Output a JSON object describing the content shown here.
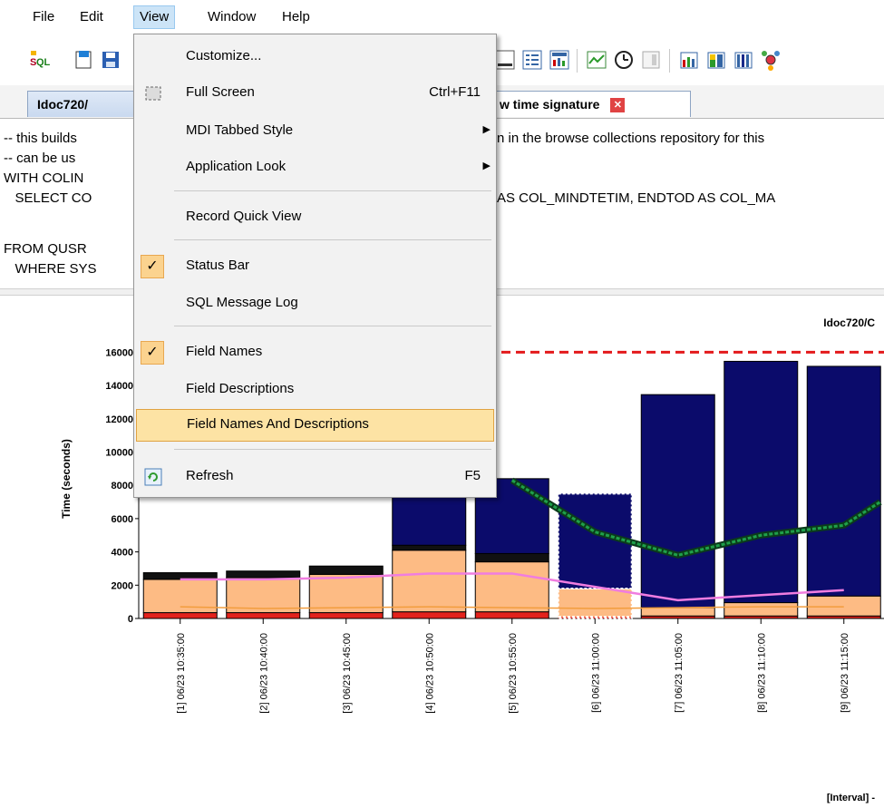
{
  "menubar": {
    "items": [
      "File",
      "Edit",
      "View",
      "Window",
      "Help"
    ]
  },
  "tabs": [
    {
      "label": "Idoc720/"
    },
    {
      "label": "w time signature"
    }
  ],
  "editor": {
    "lines": [
      "-- this builds",
      "-- can be us",
      "WITH COLIN",
      "   SELECT CO",
      "FROM QUSR",
      "   WHERE SYS"
    ],
    "right_fragments": [
      "n in the browse collections repository for this",
      "AS COL_MINDTETIM, ENDTOD AS COL_MA"
    ]
  },
  "view_menu": {
    "items": [
      {
        "label": "Customize...",
        "shortcut": "",
        "submenu": false,
        "checked": false
      },
      {
        "label": "Full Screen",
        "shortcut": "Ctrl+F11",
        "submenu": false,
        "checked": false
      },
      {
        "label": "MDI Tabbed Style",
        "shortcut": "",
        "submenu": true,
        "checked": false
      },
      {
        "label": "Application Look",
        "shortcut": "",
        "submenu": true,
        "checked": false
      },
      {
        "label": "Record Quick View",
        "shortcut": "",
        "submenu": false,
        "checked": false
      },
      {
        "label": "Status Bar",
        "shortcut": "",
        "submenu": false,
        "checked": true
      },
      {
        "label": "SQL Message Log",
        "shortcut": "",
        "submenu": false,
        "checked": false
      },
      {
        "label": "Field Names",
        "shortcut": "",
        "submenu": false,
        "checked": true
      },
      {
        "label": "Field Descriptions",
        "shortcut": "",
        "submenu": false,
        "checked": false
      },
      {
        "label": "Field Names And Descriptions",
        "shortcut": "",
        "submenu": false,
        "checked": false,
        "highlighted": true
      },
      {
        "label": "Refresh",
        "shortcut": "F5",
        "submenu": false,
        "checked": false
      }
    ]
  },
  "chart_data": {
    "type": "bar",
    "title": "Idoc720/C",
    "ylabel": "Time (seconds)",
    "xlabel": "[Interval] -",
    "ylim": [
      0,
      17000
    ],
    "yticks": [
      0,
      2000,
      4000,
      6000,
      8000,
      10000,
      12000,
      14000,
      16000
    ],
    "categories": [
      "[1] 06/23 10:35:00",
      "[2] 06/23 10:40:00",
      "[3] 06/23 10:45:00",
      "[4] 06/23 10:50:00",
      "[5] 06/23 10:55:00",
      "[6] 06/23 11:00:00",
      "[7] 06/23 11:05:00",
      "[8] 06/23 11:10:00",
      "[9] 06/23 11:15:00"
    ],
    "stacks": {
      "red": [
        350,
        350,
        350,
        400,
        400,
        100,
        150,
        150,
        150
      ],
      "orange": [
        2000,
        2100,
        2300,
        3700,
        3000,
        1700,
        500,
        800,
        1200
      ],
      "black": [
        400,
        400,
        500,
        300,
        500,
        0,
        0,
        0,
        0
      ],
      "navy": [
        0,
        0,
        0,
        4000,
        4500,
        5700,
        12800,
        14500,
        13800
      ]
    },
    "lines": {
      "green": [
        null,
        null,
        null,
        null,
        8300,
        5200,
        3800,
        5000,
        5600
      ],
      "pink": [
        2350,
        2350,
        2450,
        2700,
        2700,
        1900,
        1100,
        1400,
        1700
      ],
      "orange_line": [
        700,
        600,
        650,
        700,
        650,
        600,
        650,
        700,
        700
      ]
    },
    "threshold": 16000,
    "colors": {
      "red": "#e3221c",
      "orange": "#fdbb84",
      "black": "#111111",
      "navy": "#0b0b6b",
      "green": "#1fa04a",
      "pink": "#f07de0",
      "orange_line": "#f29d3e",
      "threshold": "#e31a1c"
    }
  }
}
